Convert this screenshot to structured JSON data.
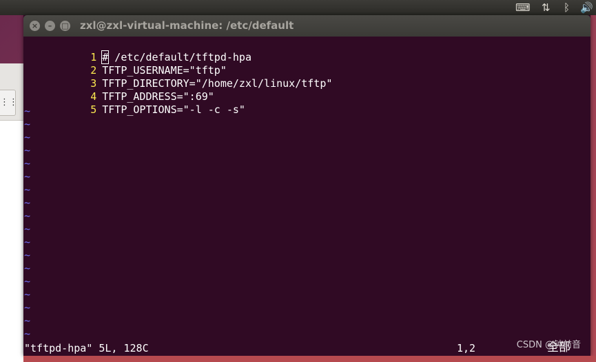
{
  "top_panel": {
    "icons": [
      "keyboard-icon",
      "network-arrows-icon",
      "bluetooth-icon",
      "volume-icon"
    ]
  },
  "window": {
    "title": "zxl@zxl-virtual-machine: /etc/default",
    "buttons": {
      "close": "×",
      "minimize": "–",
      "maximize": "□"
    }
  },
  "editor": {
    "lines": [
      {
        "num": "1",
        "text": "# /etc/default/tftpd-hpa"
      },
      {
        "num": "2",
        "text": "TFTP_USERNAME=\"tftp\""
      },
      {
        "num": "3",
        "text": "TFTP_DIRECTORY=\"/home/zxl/linux/tftp\""
      },
      {
        "num": "4",
        "text": "TFTP_ADDRESS=\":69\""
      },
      {
        "num": "5",
        "text": "TFTP_OPTIONS=\"-l -c -s\""
      }
    ],
    "tilde": "~",
    "cursor_char": "#"
  },
  "status": {
    "file_info": "\"tftpd-hpa\" 5L, 128C",
    "position": "1,2",
    "scroll": "全部"
  },
  "watermark": "CSDN @钟前音",
  "colors": {
    "terminal_bg": "#300a24",
    "line_number": "#fce94f",
    "tilde": "#6d6df0"
  }
}
